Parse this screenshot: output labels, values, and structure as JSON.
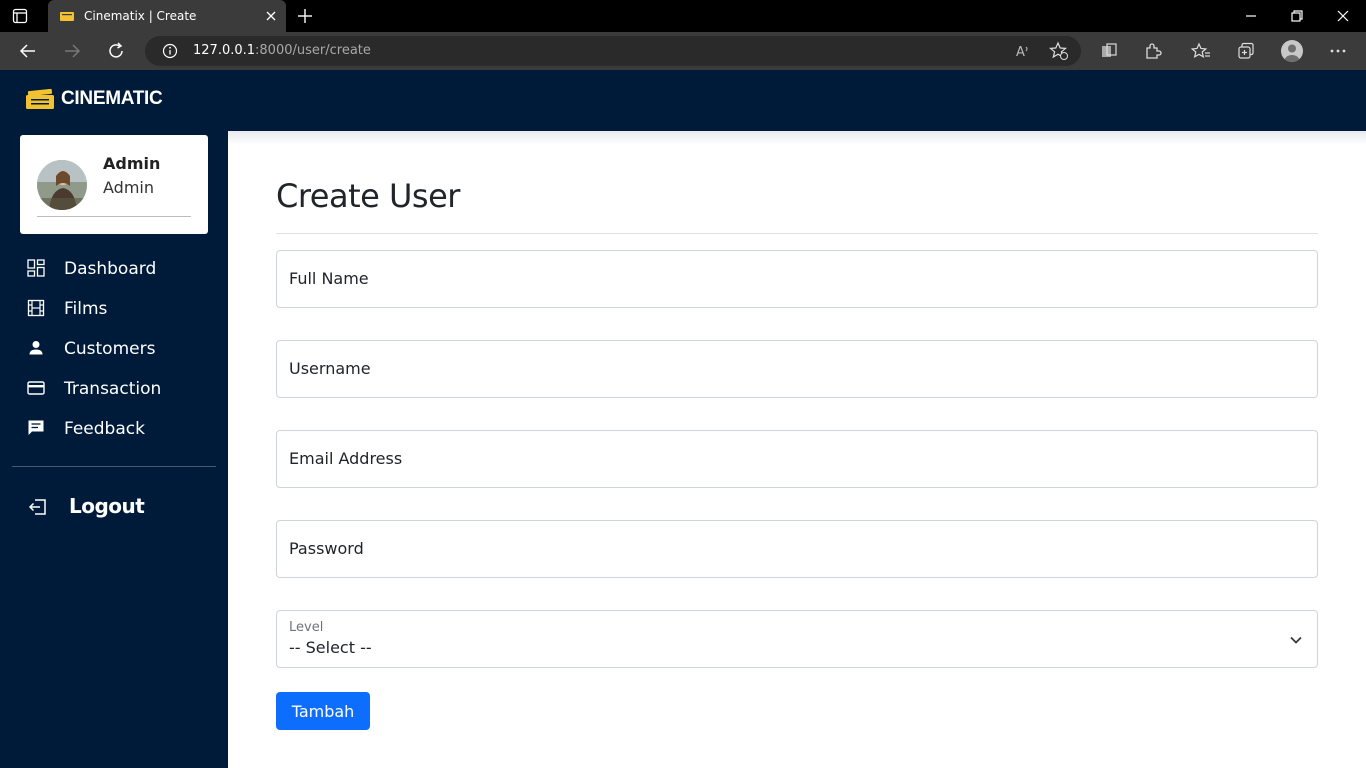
{
  "browser": {
    "tab_title": "Cinematix | Create",
    "url_host": "127.0.0.1",
    "url_rest": ":8000/user/create"
  },
  "app": {
    "brand": "CINEMATIC"
  },
  "profile": {
    "name": "Admin",
    "role": "Admin"
  },
  "sidebar": {
    "items": [
      {
        "label": "Dashboard",
        "icon": "dashboard-icon"
      },
      {
        "label": "Films",
        "icon": "film-icon"
      },
      {
        "label": "Customers",
        "icon": "person-icon"
      },
      {
        "label": "Transaction",
        "icon": "card-icon"
      },
      {
        "label": "Feedback",
        "icon": "feedback-icon"
      }
    ],
    "logout_label": "Logout"
  },
  "form": {
    "title": "Create User",
    "fields": [
      {
        "label": "Full Name"
      },
      {
        "label": "Username"
      },
      {
        "label": "Email Address"
      },
      {
        "label": "Password"
      }
    ],
    "level": {
      "label": "Level",
      "selected": "-- Select --"
    },
    "submit_label": "Tambah"
  },
  "colors": {
    "sidebar_bg": "#001b3a",
    "primary": "#0d6efd",
    "brand_icon": "#f2c230"
  }
}
